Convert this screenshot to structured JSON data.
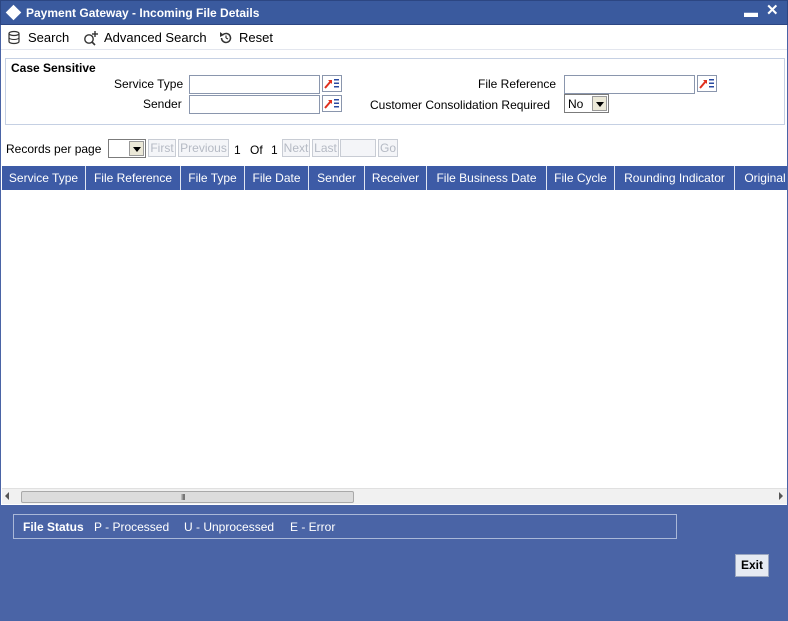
{
  "window": {
    "title": "Payment Gateway - Incoming File Details",
    "minimize_glyph": "▬",
    "close_glyph": "✕"
  },
  "toolbar": {
    "search_label": "Search",
    "advanced_search_label": "Advanced Search",
    "reset_label": "Reset"
  },
  "criteria": {
    "legend": "Case Sensitive",
    "service_type_label": "Service Type",
    "service_type_value": "",
    "sender_label": "Sender",
    "sender_value": "",
    "file_reference_label": "File Reference",
    "file_reference_value": "",
    "consolidation_label": "Customer Consolidation Required",
    "consolidation_value": "No"
  },
  "pager": {
    "records_per_page_label": "Records per page",
    "records_per_page_value": "",
    "first_label": "First",
    "previous_label": "Previous",
    "current_page": "1",
    "of_label": "Of",
    "total_pages": "1",
    "next_label": "Next",
    "last_label": "Last",
    "goto_value": "",
    "go_label": "Go"
  },
  "grid": {
    "columns": [
      "Service Type",
      "File Reference",
      "File Type",
      "File Date",
      "Sender",
      "Receiver",
      "File Business Date",
      "File Cycle",
      "Rounding Indicator",
      "Original"
    ],
    "rows": []
  },
  "scrollbar": {
    "grip": "III"
  },
  "status_legend": {
    "label": "File Status",
    "items": [
      "P - Processed",
      "U - Unprocessed",
      "E - Error"
    ]
  },
  "footer": {
    "exit_label": "Exit"
  },
  "icons": {
    "lov": "list-of-values-icon",
    "search": "search-icon",
    "advanced_search": "advanced-search-icon",
    "reset": "reset-icon"
  },
  "colors": {
    "title_bar": "#3a5a9e",
    "header": "#3d5ba6",
    "frame": "#4a64a6",
    "lov_accent": "#e0301e"
  }
}
